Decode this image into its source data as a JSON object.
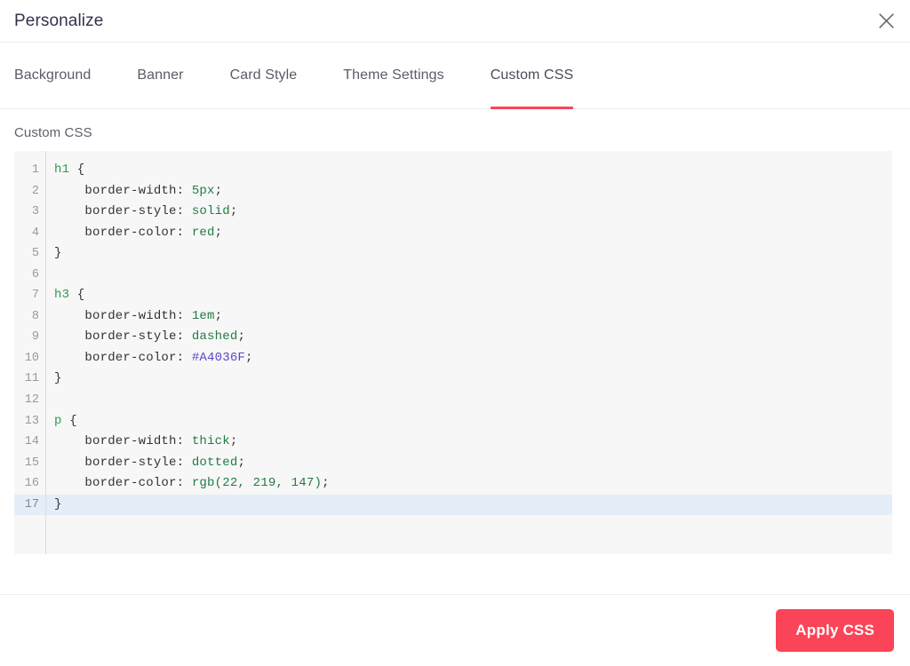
{
  "header": {
    "title": "Personalize",
    "close_icon": "close-x-icon"
  },
  "tabs": [
    {
      "label": "Background",
      "active": false
    },
    {
      "label": "Banner",
      "active": false
    },
    {
      "label": "Card Style",
      "active": false
    },
    {
      "label": "Theme Settings",
      "active": false
    },
    {
      "label": "Custom CSS",
      "active": true
    }
  ],
  "body": {
    "field_label": "Custom CSS"
  },
  "editor": {
    "current_line": 17,
    "line_numbers": [
      "1",
      "2",
      "3",
      "4",
      "5",
      "6",
      "7",
      "8",
      "9",
      "10",
      "11",
      "12",
      "13",
      "14",
      "15",
      "16",
      "17"
    ],
    "lines": [
      {
        "n": 1,
        "tokens": [
          {
            "t": "h1",
            "c": "sel"
          },
          {
            "t": " {",
            "c": "pun"
          }
        ]
      },
      {
        "n": 2,
        "tokens": [
          {
            "t": "    border-width",
            "c": "prop"
          },
          {
            "t": ": ",
            "c": "pun"
          },
          {
            "t": "5px",
            "c": "val"
          },
          {
            "t": ";",
            "c": "pun"
          }
        ]
      },
      {
        "n": 3,
        "tokens": [
          {
            "t": "    border-style",
            "c": "prop"
          },
          {
            "t": ": ",
            "c": "pun"
          },
          {
            "t": "solid",
            "c": "val"
          },
          {
            "t": ";",
            "c": "pun"
          }
        ]
      },
      {
        "n": 4,
        "tokens": [
          {
            "t": "    border-color",
            "c": "prop"
          },
          {
            "t": ": ",
            "c": "pun"
          },
          {
            "t": "red",
            "c": "val"
          },
          {
            "t": ";",
            "c": "pun"
          }
        ]
      },
      {
        "n": 5,
        "tokens": [
          {
            "t": "}",
            "c": "pun"
          }
        ]
      },
      {
        "n": 6,
        "tokens": [
          {
            "t": "",
            "c": "pun"
          }
        ]
      },
      {
        "n": 7,
        "tokens": [
          {
            "t": "h3",
            "c": "sel"
          },
          {
            "t": " {",
            "c": "pun"
          }
        ]
      },
      {
        "n": 8,
        "tokens": [
          {
            "t": "    border-width",
            "c": "prop"
          },
          {
            "t": ": ",
            "c": "pun"
          },
          {
            "t": "1em",
            "c": "val"
          },
          {
            "t": ";",
            "c": "pun"
          }
        ]
      },
      {
        "n": 9,
        "tokens": [
          {
            "t": "    border-style",
            "c": "prop"
          },
          {
            "t": ": ",
            "c": "pun"
          },
          {
            "t": "dashed",
            "c": "val"
          },
          {
            "t": ";",
            "c": "pun"
          }
        ]
      },
      {
        "n": 10,
        "tokens": [
          {
            "t": "    border-color",
            "c": "prop"
          },
          {
            "t": ": ",
            "c": "pun"
          },
          {
            "t": "#A4036F",
            "c": "hex"
          },
          {
            "t": ";",
            "c": "pun"
          }
        ]
      },
      {
        "n": 11,
        "tokens": [
          {
            "t": "}",
            "c": "pun"
          }
        ]
      },
      {
        "n": 12,
        "tokens": [
          {
            "t": "",
            "c": "pun"
          }
        ]
      },
      {
        "n": 13,
        "tokens": [
          {
            "t": "p",
            "c": "sel"
          },
          {
            "t": " {",
            "c": "pun"
          }
        ]
      },
      {
        "n": 14,
        "tokens": [
          {
            "t": "    border-width",
            "c": "prop"
          },
          {
            "t": ": ",
            "c": "pun"
          },
          {
            "t": "thick",
            "c": "val"
          },
          {
            "t": ";",
            "c": "pun"
          }
        ]
      },
      {
        "n": 15,
        "tokens": [
          {
            "t": "    border-style",
            "c": "prop"
          },
          {
            "t": ": ",
            "c": "pun"
          },
          {
            "t": "dotted",
            "c": "val"
          },
          {
            "t": ";",
            "c": "pun"
          }
        ]
      },
      {
        "n": 16,
        "tokens": [
          {
            "t": "    border-color",
            "c": "prop"
          },
          {
            "t": ": ",
            "c": "pun"
          },
          {
            "t": "rgb(22, 219, 147)",
            "c": "val"
          },
          {
            "t": ";",
            "c": "pun"
          }
        ]
      },
      {
        "n": 17,
        "tokens": [
          {
            "t": "}",
            "c": "pun"
          }
        ]
      }
    ]
  },
  "footer": {
    "apply_label": "Apply CSS"
  },
  "colors": {
    "accent": "#FB4458",
    "title": "#32344A",
    "editor_bg": "#F7F7F7",
    "current_line_bg": "#E4EEF8",
    "selector": "#2E9C4A",
    "value": "#237A46",
    "hex_value": "#5B49C4",
    "divider": "#EBEDF2"
  }
}
